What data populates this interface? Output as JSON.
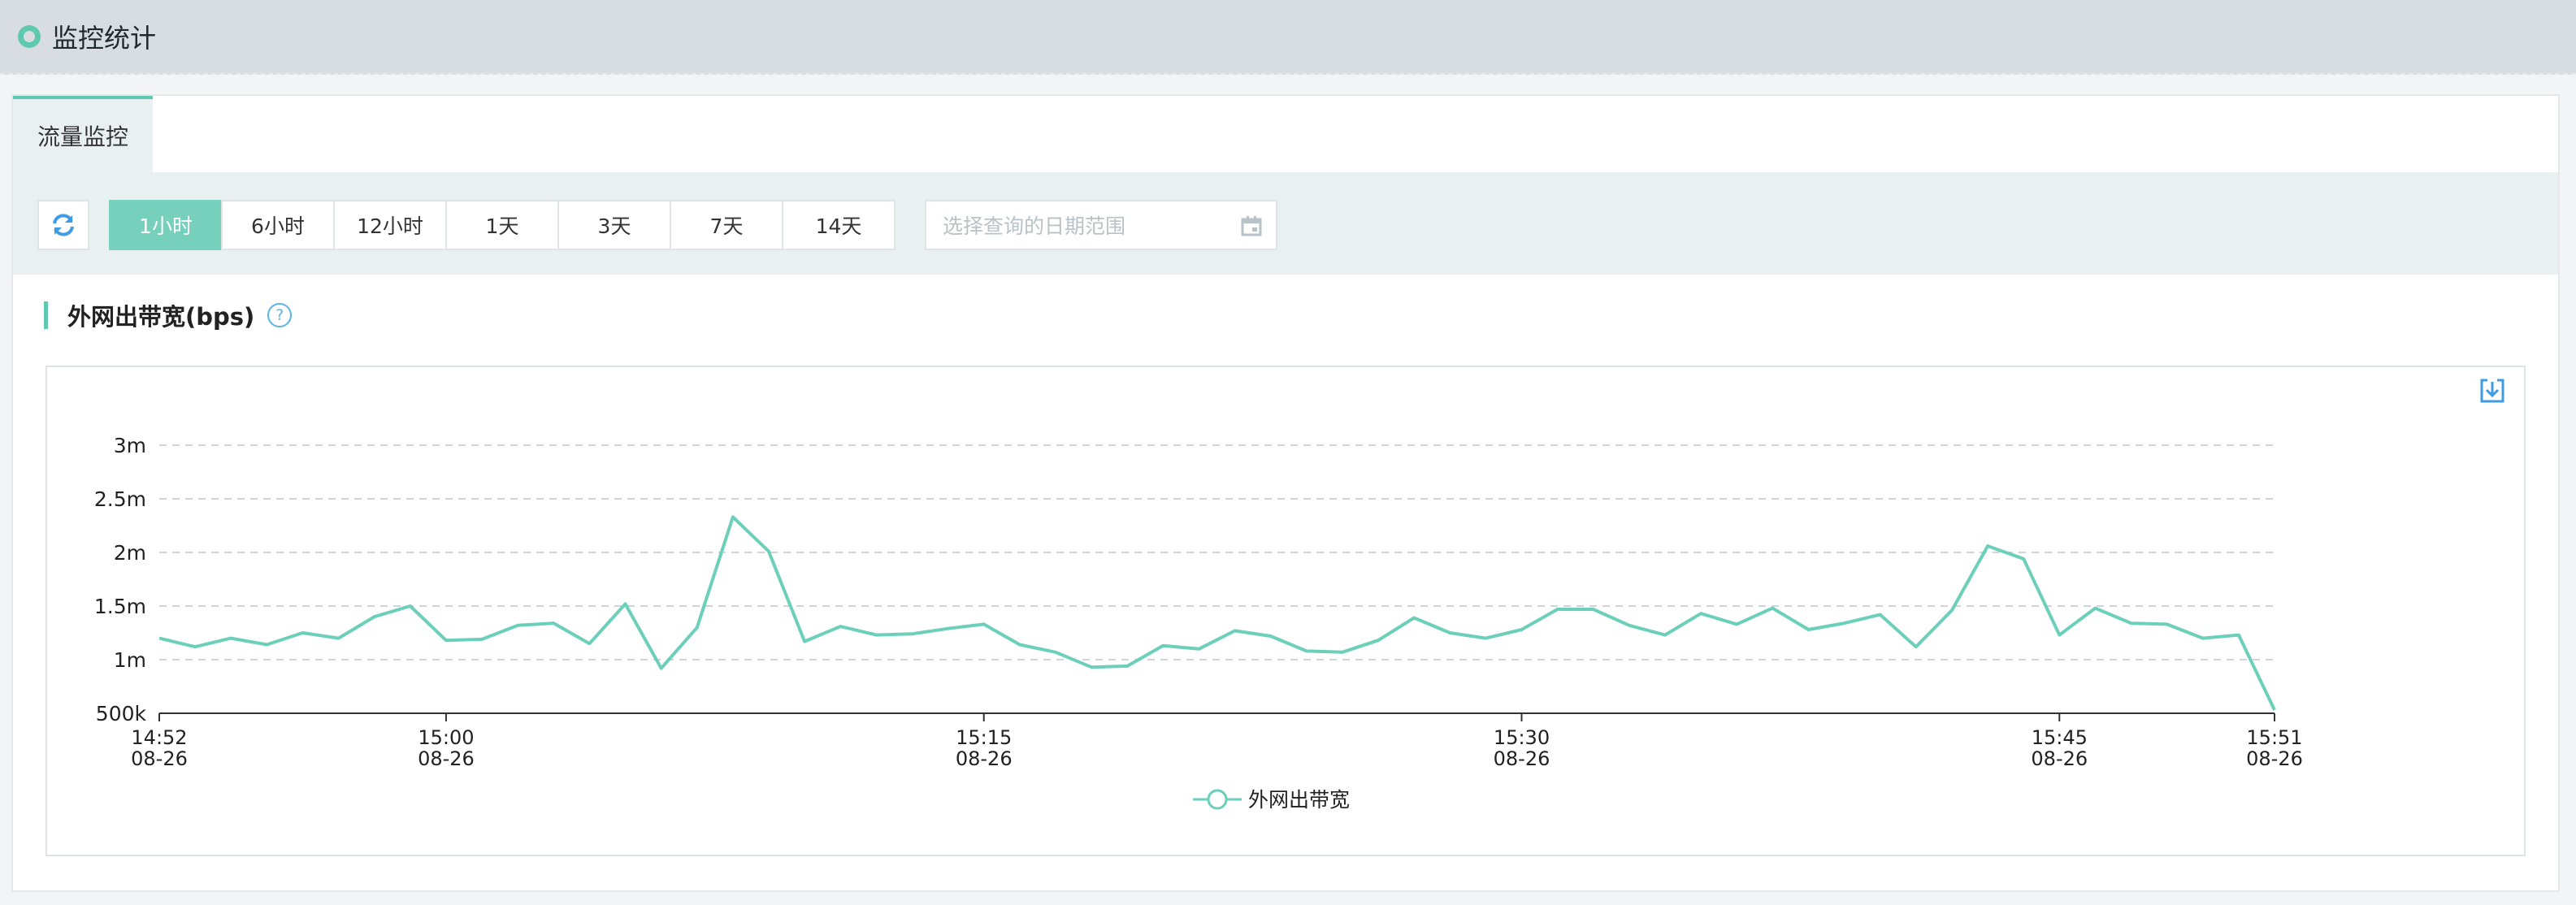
{
  "header": {
    "title": "监控统计"
  },
  "tabs": [
    {
      "label": "流量监控"
    }
  ],
  "toolbar": {
    "ranges": [
      "1小时",
      "6小时",
      "12小时",
      "1天",
      "3天",
      "7天",
      "14天"
    ],
    "active_range": "1小时",
    "date_placeholder": "选择查询的日期范围"
  },
  "section": {
    "title": "外网出带宽(bps)",
    "help": "?"
  },
  "colors": {
    "accent": "#5fc9b0",
    "line": "#6ccfb9",
    "help": "#5bb4e6"
  },
  "chart_data": {
    "type": "line",
    "title": "",
    "ylabel": "",
    "ylim": [
      500000,
      3000000
    ],
    "yticks": [
      "3m",
      "2.5m",
      "2m",
      "1.5m",
      "1m",
      "500k"
    ],
    "ytick_values": [
      3000000,
      2500000,
      2000000,
      1500000,
      1000000,
      500000
    ],
    "xticks": [
      {
        "time": "14:52",
        "date": "08-26"
      },
      {
        "time": "15:00",
        "date": "08-26"
      },
      {
        "time": "15:15",
        "date": "08-26"
      },
      {
        "time": "15:30",
        "date": "08-26"
      },
      {
        "time": "15:45",
        "date": "08-26"
      },
      {
        "time": "15:51",
        "date": "08-26"
      }
    ],
    "xtick_minutes": [
      0,
      8,
      23,
      38,
      53,
      59
    ],
    "x_range_minutes": [
      0,
      59
    ],
    "series": [
      {
        "name": "外网出带宽",
        "values": [
          1200000,
          1120000,
          1200000,
          1140000,
          1250000,
          1200000,
          1400000,
          1500000,
          1180000,
          1190000,
          1320000,
          1340000,
          1150000,
          1520000,
          920000,
          1300000,
          2330000,
          2010000,
          1170000,
          1310000,
          1230000,
          1240000,
          1290000,
          1330000,
          1140000,
          1070000,
          930000,
          940000,
          1130000,
          1100000,
          1270000,
          1220000,
          1080000,
          1070000,
          1180000,
          1390000,
          1250000,
          1200000,
          1280000,
          1470000,
          1470000,
          1320000,
          1230000,
          1430000,
          1330000,
          1480000,
          1280000,
          1340000,
          1420000,
          1120000,
          1460000,
          2060000,
          1940000,
          1230000,
          1480000,
          1340000,
          1330000,
          1200000,
          1230000,
          530000
        ]
      }
    ],
    "legend_position": "bottom-center"
  }
}
